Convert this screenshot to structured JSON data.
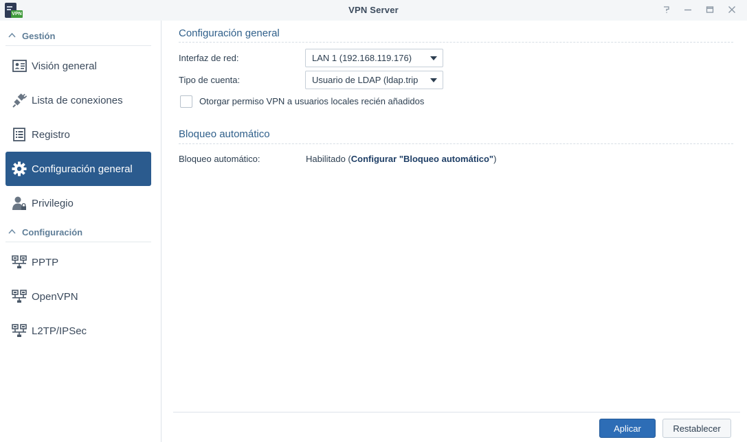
{
  "window": {
    "title": "VPN Server",
    "app_icon_badge": "VPN",
    "controls": {
      "help": "help-icon",
      "minimize": "minimize-icon",
      "maximize": "maximize-icon",
      "close": "close-icon"
    }
  },
  "sidebar": {
    "sections": [
      {
        "label": "Gestión",
        "items": [
          {
            "label": "Visión general",
            "icon": "overview-icon"
          },
          {
            "label": "Lista de conexiones",
            "icon": "plug-icon"
          },
          {
            "label": "Registro",
            "icon": "log-icon"
          },
          {
            "label": "Configuración general",
            "icon": "gear-icon",
            "active": true
          },
          {
            "label": "Privilegio",
            "icon": "user-lock-icon"
          }
        ]
      },
      {
        "label": "Configuración",
        "items": [
          {
            "label": "PPTP",
            "icon": "network-icon"
          },
          {
            "label": "OpenVPN",
            "icon": "network-icon"
          },
          {
            "label": "L2TP/IPSec",
            "icon": "network-icon"
          }
        ]
      }
    ]
  },
  "main": {
    "general": {
      "title": "Configuración general",
      "network_interface": {
        "label": "Interfaz de red:",
        "value": "LAN 1 (192.168.119.176)"
      },
      "account_type": {
        "label": "Tipo de cuenta:",
        "value": "Usuario de LDAP (ldap.trip"
      },
      "grant_checkbox": {
        "label": "Otorgar permiso VPN a usuarios locales recién añadidos",
        "checked": false
      }
    },
    "autoblock": {
      "title": "Bloqueo automático",
      "label": "Bloqueo automático:",
      "status_prefix": "Habilitado (",
      "link": "Configurar \"Bloqueo automático\"",
      "status_suffix": ")"
    }
  },
  "footer": {
    "apply": "Aplicar",
    "reset": "Restablecer"
  },
  "colors": {
    "accent": "#2b5b8e",
    "primary_button": "#2d6db6",
    "section_label": "#5e7d97"
  }
}
